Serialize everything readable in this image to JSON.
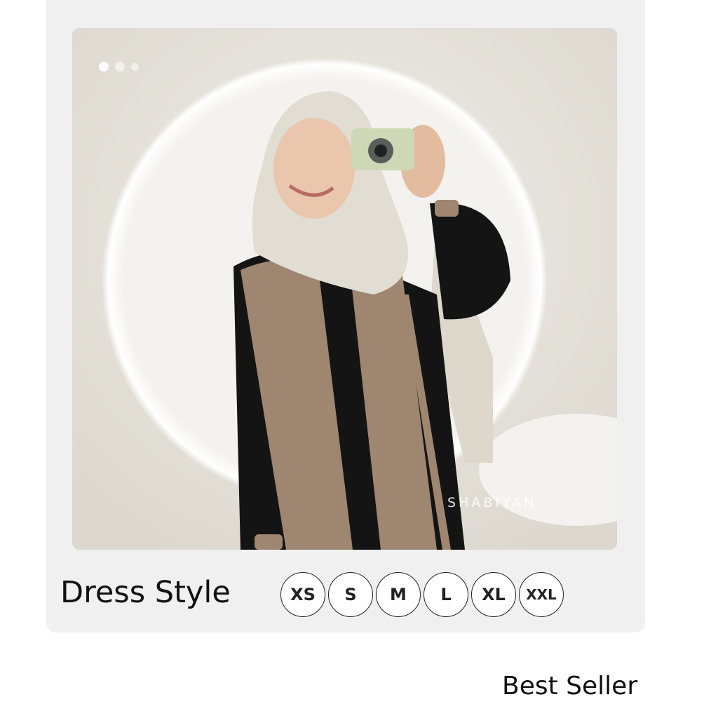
{
  "product": {
    "title": "Dress Style",
    "badge": "Best Seller",
    "watermark": "SHABIYAN",
    "image_description_icon": "model-photo",
    "carousel": {
      "total": 3,
      "active": 1
    }
  },
  "sizes": [
    {
      "label": "XS"
    },
    {
      "label": "S"
    },
    {
      "label": "M"
    },
    {
      "label": "L"
    },
    {
      "label": "XL"
    },
    {
      "label": "XXL"
    }
  ],
  "colors": {
    "card_bg": "#f0f0f0",
    "dress_tan": "#9e8670",
    "dress_black": "#141414",
    "hijab": "#e2ddd3"
  }
}
